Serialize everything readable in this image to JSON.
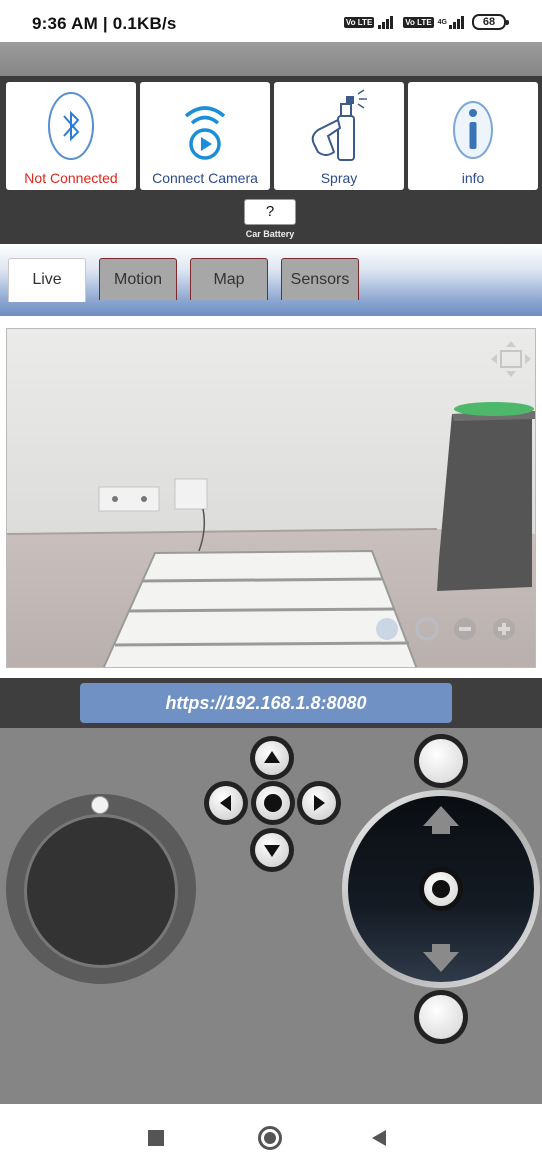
{
  "status_bar": {
    "time": "9:36 AM | 0.1KB/s",
    "sim1_tag": "Vo LTE",
    "sim2_tag": "Vo LTE",
    "network_type": "4G",
    "battery_level": "68"
  },
  "tiles": [
    {
      "label": "Not Connected",
      "icon": "bluetooth-icon"
    },
    {
      "label": "Connect Camera",
      "icon": "wifi-camera-icon"
    },
    {
      "label": "Spray",
      "icon": "spray-icon"
    },
    {
      "label": "info",
      "icon": "info-icon"
    }
  ],
  "car_battery": {
    "value": "?",
    "label": "Car  Battery"
  },
  "tabs": [
    {
      "label": "Live",
      "active": true
    },
    {
      "label": "Motion",
      "active": false
    },
    {
      "label": "Map",
      "active": false
    },
    {
      "label": "Sensors",
      "active": false
    }
  ],
  "camera": {
    "url": "https://192.168.1.8:8080"
  },
  "colors": {
    "not_connected": "#e0261b",
    "tile_label": "#2b4b8c",
    "url_bar": "#7091c4",
    "controls_bg": "#858585",
    "panel_bg": "#3c3c3c"
  }
}
